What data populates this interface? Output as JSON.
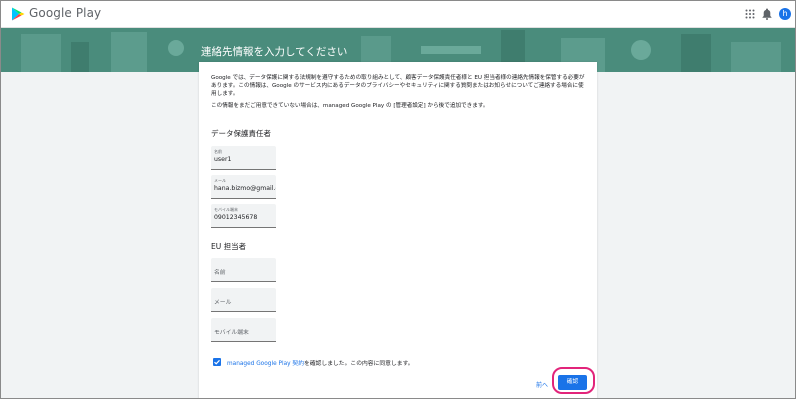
{
  "header": {
    "brand": "Google Play",
    "avatar_initial": "h"
  },
  "hero": {
    "title": "連絡先情報を入力してください"
  },
  "intro": {
    "para1": "Google では、データ保護に関する法規制を遵守するための取り組みとして、顧客データ保護責任者様と EU 担当者様の連絡先情報を保管する必要があります。この情報は、Google のサービス内にあるデータのプライバシーやセキュリティに関する質問またはお知らせについてご連絡する場合に使用します。",
    "para2": "この情報をまだご用意できていない場合は、managed Google Play の [管理者設定] から後で追加できます。"
  },
  "dpo": {
    "title": "データ保護責任者",
    "name_label": "名前",
    "name_value": "user1",
    "email_label": "メール",
    "email_value": "hana.bizmo@gmail.cc",
    "phone_label": "モバイル端末",
    "phone_value": "09012345678"
  },
  "eu": {
    "title": "EU 担当者",
    "name_placeholder": "名前",
    "email_placeholder": "メール",
    "phone_placeholder": "モバイル端末"
  },
  "consent": {
    "link": "managed Google Play 契約",
    "text": "を確認しました。この内容に同意します。",
    "checked": true
  },
  "actions": {
    "back": "前へ",
    "confirm": "確認"
  },
  "colors": {
    "accent": "#1a73e8",
    "hero": "#4a8c7c",
    "highlight": "#e2247a"
  }
}
